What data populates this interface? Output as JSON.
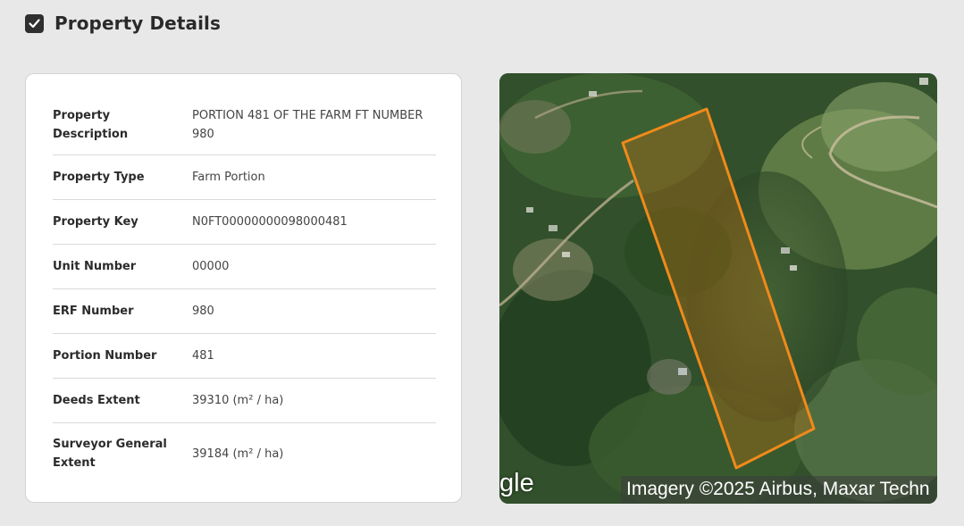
{
  "section": {
    "title": "Property Details",
    "checked": true
  },
  "details": [
    {
      "label": "Property Description",
      "value": "PORTION 481 OF THE FARM FT NUMBER 980"
    },
    {
      "label": "Property Type",
      "value": "Farm Portion"
    },
    {
      "label": "Property Key",
      "value": "N0FT00000000098000481"
    },
    {
      "label": "Unit Number",
      "value": "00000"
    },
    {
      "label": "ERF Number",
      "value": "980"
    },
    {
      "label": "Portion Number",
      "value": "481"
    },
    {
      "label": "Deeds Extent",
      "value": "39310 (m² / ha)"
    },
    {
      "label": "Surveyor General Extent",
      "value": "39184 (m² / ha)"
    }
  ],
  "map": {
    "logo_text": "gle",
    "attribution": "Imagery ©2025 Airbus, Maxar Techn",
    "boundary_color": "#f08a1a"
  }
}
